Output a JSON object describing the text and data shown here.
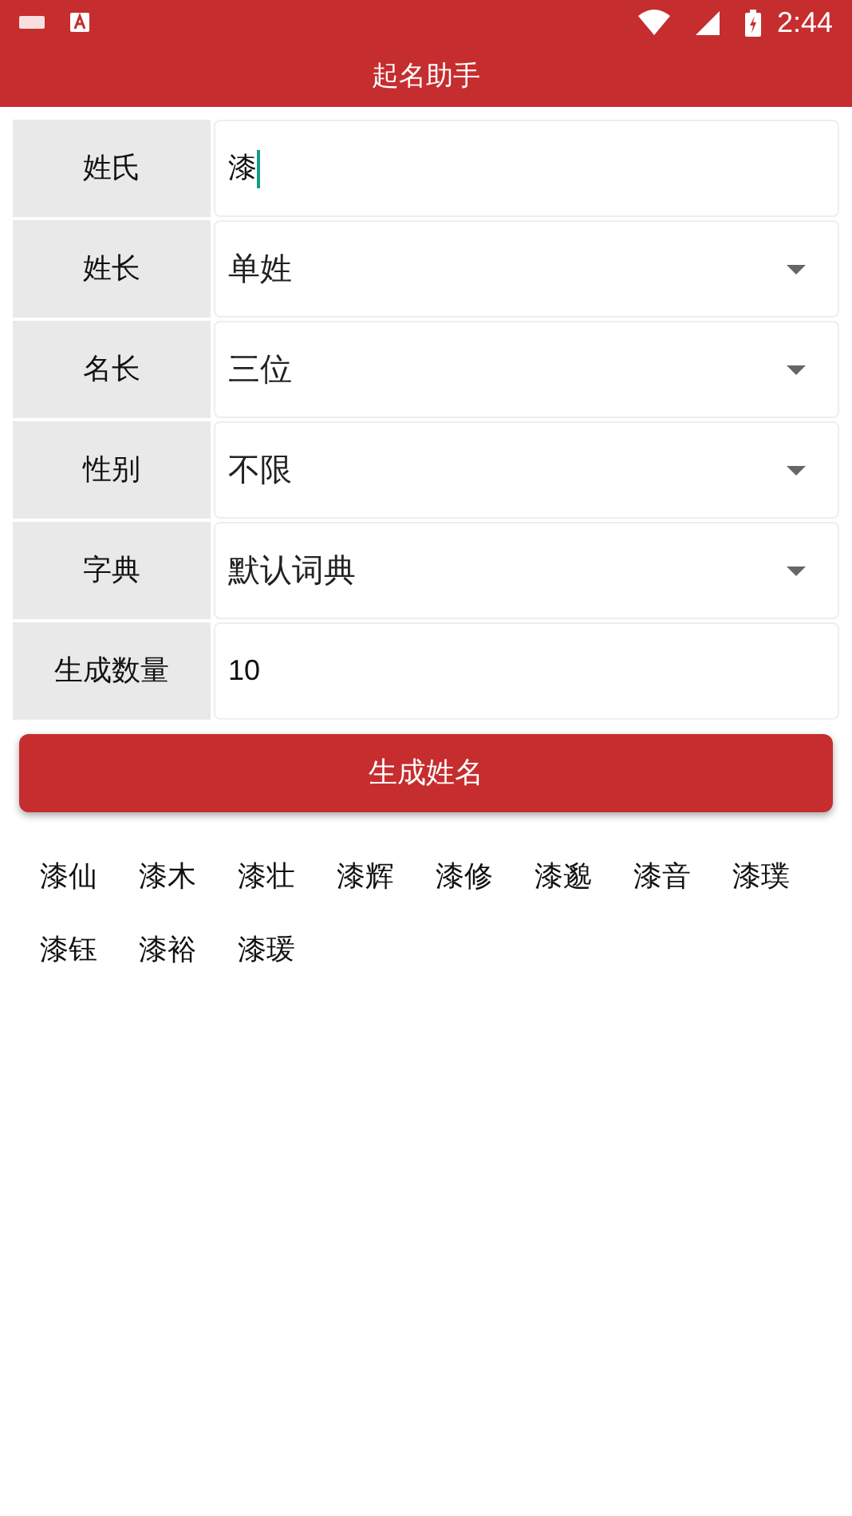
{
  "status_bar": {
    "time": "2:44"
  },
  "title": "起名助手",
  "form": [
    {
      "kind": "input",
      "label": "姓氏",
      "value": "漆",
      "focused": true
    },
    {
      "kind": "select",
      "label": "姓长",
      "value": "单姓"
    },
    {
      "kind": "select",
      "label": "名长",
      "value": "三位"
    },
    {
      "kind": "select",
      "label": "性别",
      "value": "不限"
    },
    {
      "kind": "select",
      "label": "字典",
      "value": "默认词典"
    },
    {
      "kind": "input",
      "label": "生成数量",
      "value": "10",
      "focused": false
    }
  ],
  "generate_button": "生成姓名",
  "names": [
    "漆仙",
    "漆木",
    "漆壮",
    "漆辉",
    "漆修",
    "漆邈",
    "漆音",
    "漆璞",
    "漆钰",
    "漆裕",
    "漆瑗"
  ]
}
